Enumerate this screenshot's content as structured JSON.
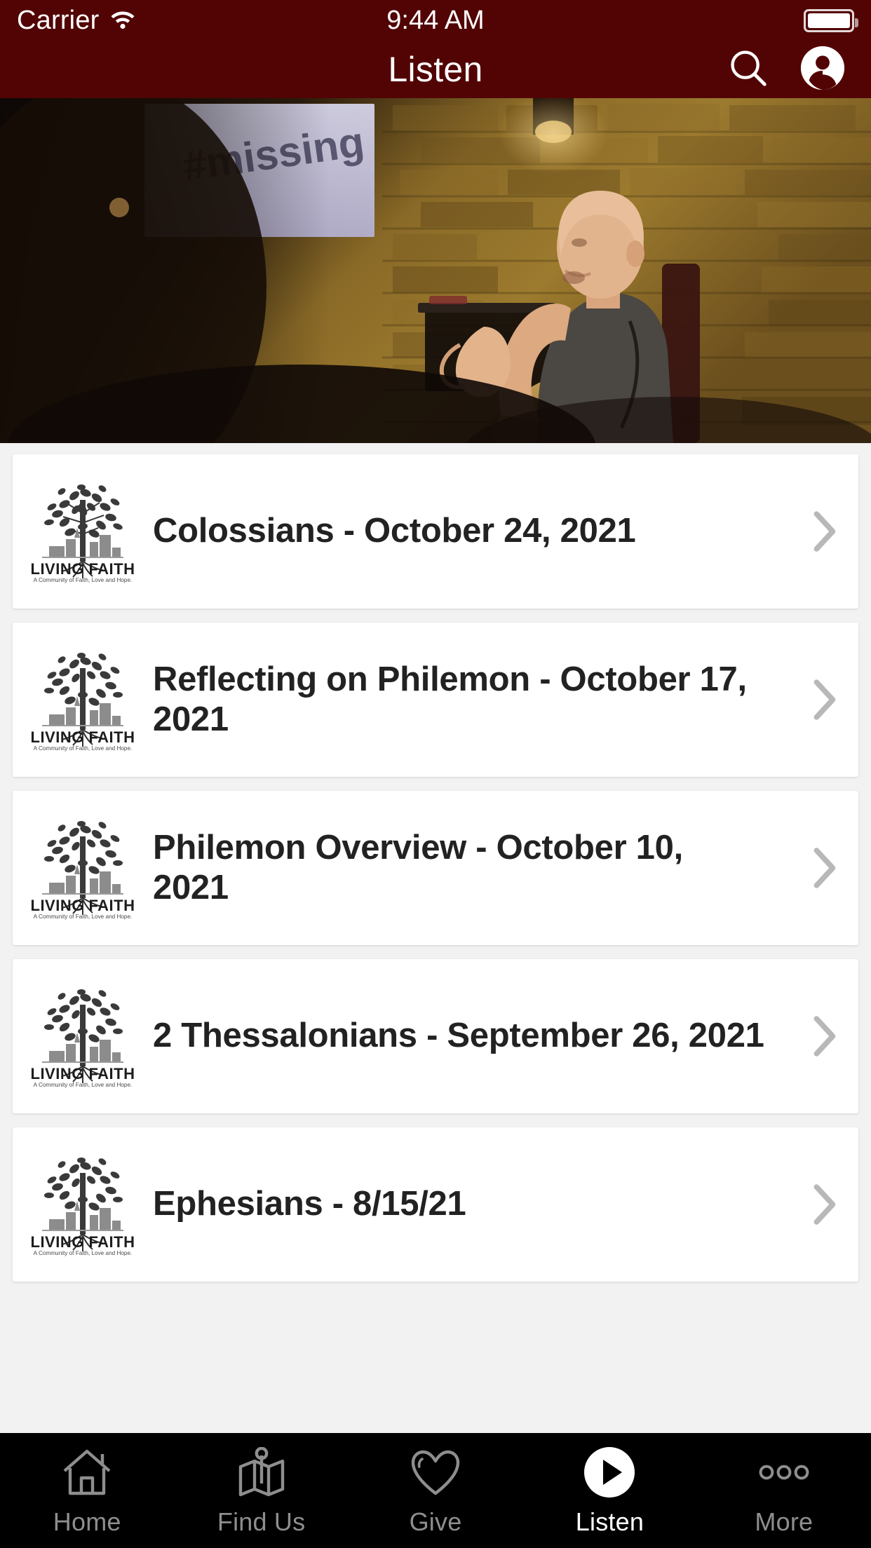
{
  "statusbar": {
    "carrier": "Carrier",
    "wifi_icon": "wifi-icon",
    "time": "9:44 AM",
    "battery_icon": "battery-full-icon"
  },
  "navbar": {
    "title": "Listen",
    "search_icon": "search-icon",
    "profile_icon": "account-circle-icon"
  },
  "hero": {
    "name": "sermon-hero-image",
    "alt": "Speaker seated in front of exposed brick wall with projection screen",
    "screen_text": "#missing"
  },
  "logo": {
    "name": "living-faith-logo",
    "wordmark": "LIVING FAITH",
    "tagline": "A Community of Faith, Love and Hope."
  },
  "sermons": [
    {
      "title": "Colossians - October 24, 2021"
    },
    {
      "title": "Reflecting on Philemon - October 17, 2021"
    },
    {
      "title": "Philemon Overview - October 10, 2021"
    },
    {
      "title": "2 Thessalonians - September 26, 2021"
    },
    {
      "title": "Ephesians - 8/15/21"
    }
  ],
  "chevron_icon": "chevron-right-icon",
  "tabbar": {
    "items": [
      {
        "label": "Home",
        "icon": "home-icon",
        "active": false
      },
      {
        "label": "Find Us",
        "icon": "map-pin-icon",
        "active": false
      },
      {
        "label": "Give",
        "icon": "heart-icon",
        "active": false
      },
      {
        "label": "Listen",
        "icon": "play-circle-icon",
        "active": true
      },
      {
        "label": "More",
        "icon": "ellipsis-icon",
        "active": false
      }
    ]
  },
  "colors": {
    "navbar": "#520404",
    "page_background": "#f2f2f2",
    "card_background": "#ffffff",
    "tabbar_background": "#000000",
    "tab_inactive": "#8e8e8e",
    "tab_active": "#ffffff",
    "chevron": "#b8b8b8",
    "title_text": "#222222"
  }
}
